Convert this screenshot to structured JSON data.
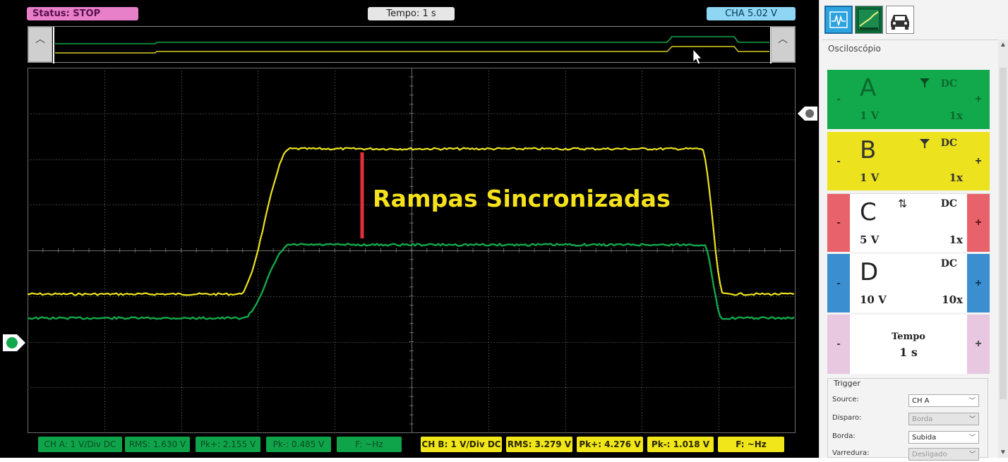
{
  "header": {
    "status": "Status: STOP",
    "tempo": "Tempo: 1 s",
    "cha": "CHA 5.02 V"
  },
  "annotation": "Rampas Sincronizadas",
  "measurements": {
    "a": [
      "CH A: 1 V/Div DC",
      "RMS: 1.630 V",
      "Pk+: 2.155 V",
      "Pk-: 0.485 V",
      "F: ~Hz"
    ],
    "b": [
      "CH B: 1 V/Div DC",
      "RMS: 3.279 V",
      "Pk+: 4.276 V",
      "Pk-: 1.018 V",
      "F: ~Hz"
    ]
  },
  "panel": {
    "title": "Osciloscópio",
    "channels": [
      {
        "letter": "A",
        "volt": "1 V",
        "mode": "DC",
        "probe": "1x",
        "minus": "-",
        "plus": "+"
      },
      {
        "letter": "B",
        "volt": "1 V",
        "mode": "DC",
        "probe": "1x",
        "minus": "-",
        "plus": "+"
      },
      {
        "letter": "C",
        "volt": "5 V",
        "mode": "DC",
        "probe": "1x",
        "minus": "-",
        "plus": "+"
      },
      {
        "letter": "D",
        "volt": "10 V",
        "mode": "DC",
        "probe": "10x",
        "minus": "-",
        "plus": "+"
      }
    ],
    "tempo": {
      "label": "Tempo",
      "value": "1 s",
      "minus": "-",
      "plus": "+"
    },
    "trigger": {
      "title": "Trigger",
      "rows": [
        {
          "label": "Source:",
          "value": "CH A",
          "disabled": false
        },
        {
          "label": "Disparo:",
          "value": "Borda",
          "disabled": true
        },
        {
          "label": "Borda:",
          "value": "Subida",
          "disabled": false
        },
        {
          "label": "Varredura:",
          "value": "Desligado",
          "disabled": true
        }
      ]
    }
  },
  "colors": {
    "channel_a": "#12a84c",
    "channel_b": "#ece31e",
    "channel_c": "#e8626b",
    "channel_d": "#3b8ed0",
    "tempo": "#e8c7e0",
    "status": "#e87fc9",
    "cha_pill": "#8fd6f5",
    "annotation_bar": "#e0303a"
  },
  "icons": [
    "oscilloscope-icon",
    "graph-icon",
    "car-icon",
    "filter-icon",
    "swap-icon",
    "chevron-up-icon",
    "chevron-down-icon"
  ]
}
